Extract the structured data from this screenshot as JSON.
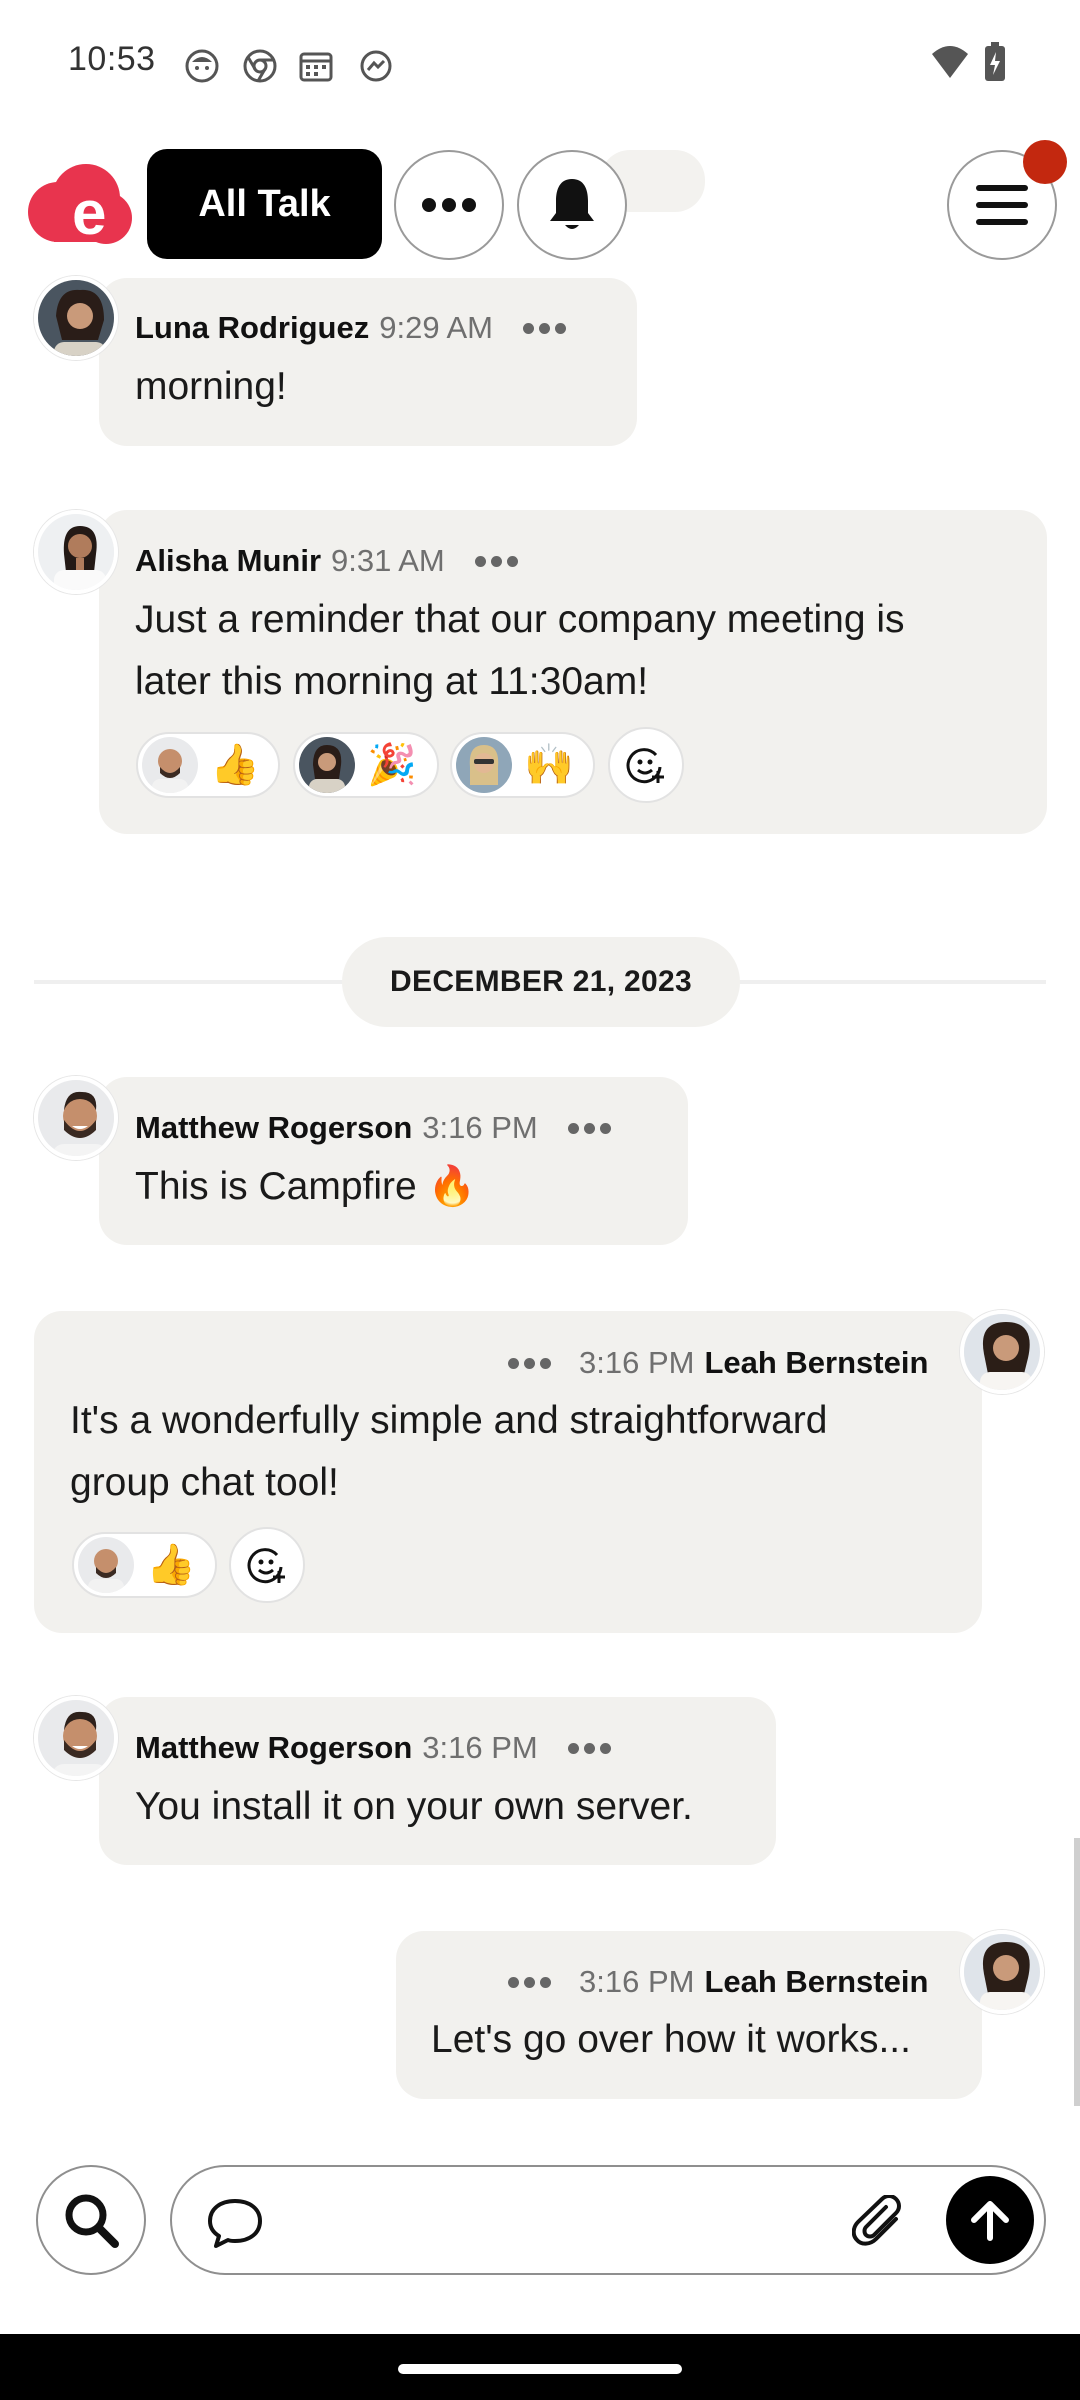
{
  "status_bar": {
    "time": "10:53"
  },
  "header": {
    "channel_label": "All Talk"
  },
  "messages": [
    {
      "author": "Luna Rodriguez",
      "time": "9:29 AM",
      "text": "morning!"
    },
    {
      "author": "Alisha Munir",
      "time": "9:31 AM",
      "text_line1": "Just a reminder that our company meeting is",
      "text_line2": "later this morning at 11:30am!",
      "reactions": [
        {
          "emoji": "👍"
        },
        {
          "emoji": "🎉"
        },
        {
          "emoji": "🙌"
        }
      ]
    },
    {
      "author": "Matthew Rogerson",
      "time": "3:16 PM",
      "text": "This is Campfire 🔥"
    },
    {
      "author": "Leah Bernstein",
      "time": "3:16 PM",
      "text_line1": "It's a wonderfully simple and straightforward",
      "text_line2": "group chat tool!",
      "reactions": [
        {
          "emoji": "👍"
        }
      ]
    },
    {
      "author": "Matthew Rogerson",
      "time": "3:16 PM",
      "text": "You install it on your own server."
    },
    {
      "author": "Leah Bernstein",
      "time": "3:16 PM",
      "text": "Let's go over how it works..."
    }
  ],
  "date_separator": "DECEMBER 21, 2023",
  "composer": {
    "placeholder": ""
  },
  "colors": {
    "brand": "#e8344e",
    "notification": "#c3280f",
    "bubble": "#f2f1ee"
  },
  "icons": [
    "face-icon",
    "chrome-icon",
    "calendar-icon",
    "messenger-icon",
    "wifi-icon",
    "battery-icon",
    "more-icon",
    "bell-icon",
    "menu-icon",
    "add-reaction-icon",
    "search-icon",
    "chat-bubble-icon",
    "paperclip-icon",
    "arrow-up-icon"
  ]
}
